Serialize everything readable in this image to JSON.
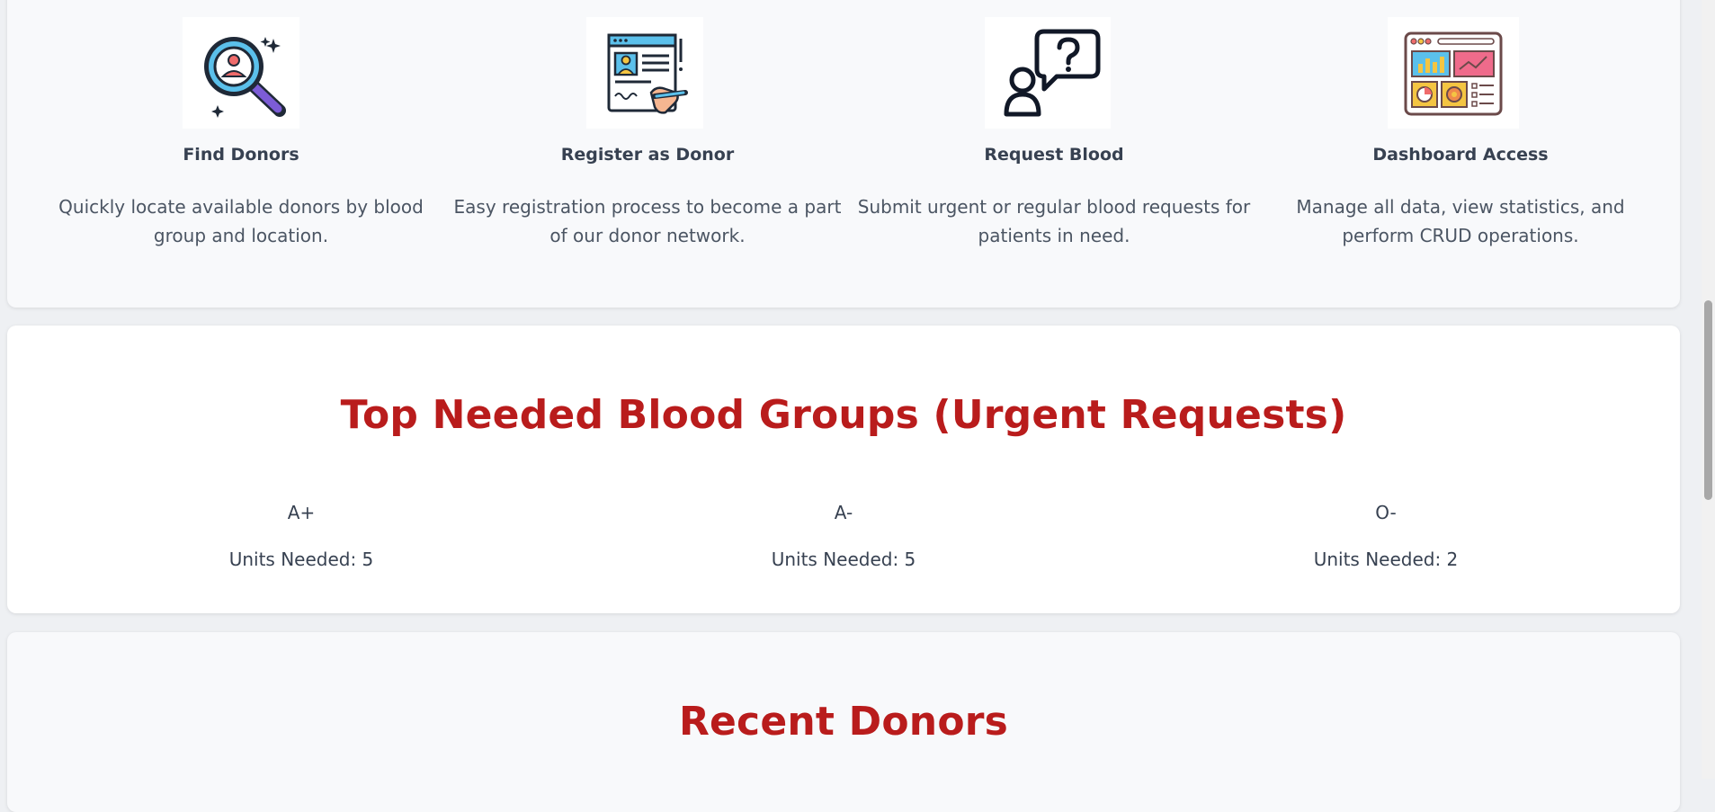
{
  "features": [
    {
      "icon": "magnifier-user-icon",
      "title": "Find Donors",
      "description": "Quickly locate available donors by blood group and location."
    },
    {
      "icon": "registration-form-icon",
      "title": "Register as Donor",
      "description": "Easy registration process to become a part of our donor network."
    },
    {
      "icon": "person-question-icon",
      "title": "Request Blood",
      "description": "Submit urgent or regular blood requests for patients in need."
    },
    {
      "icon": "dashboard-icon",
      "title": "Dashboard Access",
      "description": "Manage all data, view statistics, and perform CRUD operations."
    }
  ],
  "urgent": {
    "title": "Top Needed Blood Groups (Urgent Requests)",
    "groups": [
      {
        "group": "A+",
        "units": "Units Needed: 5"
      },
      {
        "group": "A-",
        "units": "Units Needed: 5"
      },
      {
        "group": "O-",
        "units": "Units Needed: 2"
      }
    ]
  },
  "recent": {
    "title": "Recent Donors"
  },
  "colors": {
    "accent": "#b91c1c",
    "card_bg": "#f8f9fb",
    "page_bg": "#eef0f3"
  }
}
